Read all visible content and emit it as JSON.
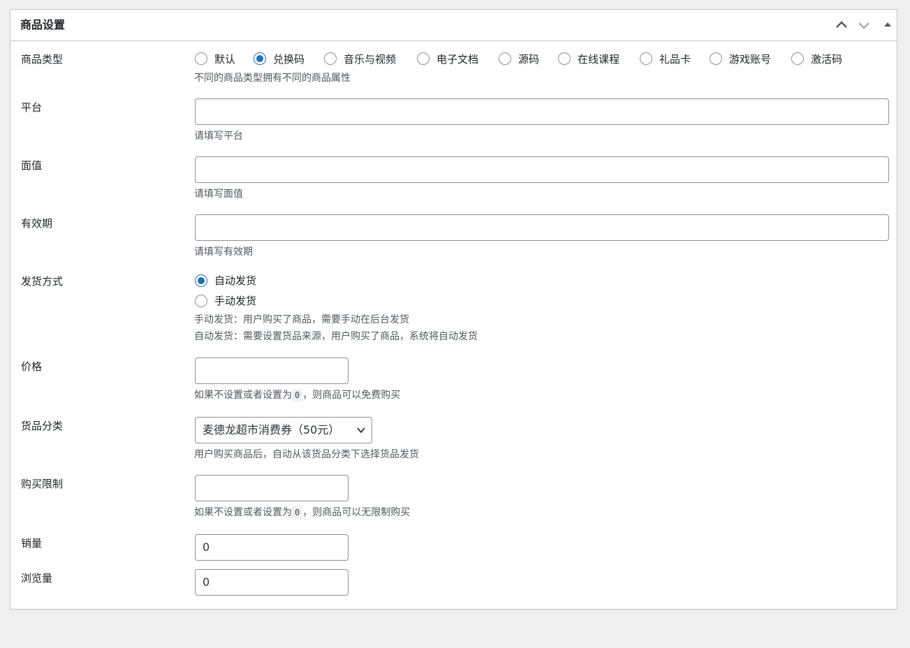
{
  "panel": {
    "title": "商品设置"
  },
  "product_type": {
    "label": "商品类型",
    "options": [
      "默认",
      "兑换码",
      "音乐与视频",
      "电子文档",
      "源码",
      "在线课程",
      "礼品卡",
      "游戏账号",
      "激活码"
    ],
    "selected": "兑换码",
    "description": "不同的商品类型拥有不同的商品属性"
  },
  "platform": {
    "label": "平台",
    "value": "",
    "description": "请填写平台"
  },
  "face_value": {
    "label": "面值",
    "value": "",
    "description": "请填写面值"
  },
  "validity": {
    "label": "有效期",
    "value": "",
    "description": "请填写有效期"
  },
  "delivery": {
    "label": "发货方式",
    "options": [
      "自动发货",
      "手动发货"
    ],
    "selected": "自动发货",
    "description_manual": "手动发货：用户购买了商品，需要手动在后台发货",
    "description_auto": "自动发货：需要设置货品来源，用户购买了商品，系统将自动发货"
  },
  "price": {
    "label": "价格",
    "value": "",
    "desc_before": "如果不设置或者设置为",
    "desc_code": "0",
    "desc_after": "，则商品可以免费购买"
  },
  "goods_category": {
    "label": "货品分类",
    "selected": "麦德龙超市消费券（50元）",
    "description": "用户购买商品后，自动从该货品分类下选择货品发货"
  },
  "purchase_limit": {
    "label": "购买限制",
    "value": "",
    "desc_before": "如果不设置或者设置为",
    "desc_code": "0",
    "desc_after": "，则商品可以无限制购买"
  },
  "sales": {
    "label": "销量",
    "value": "0"
  },
  "views": {
    "label": "浏览量",
    "value": "0"
  },
  "colors": {
    "accent": "#2271b1",
    "border": "#8c8f94",
    "description": "#50575e",
    "background": "#f0f0f1"
  }
}
